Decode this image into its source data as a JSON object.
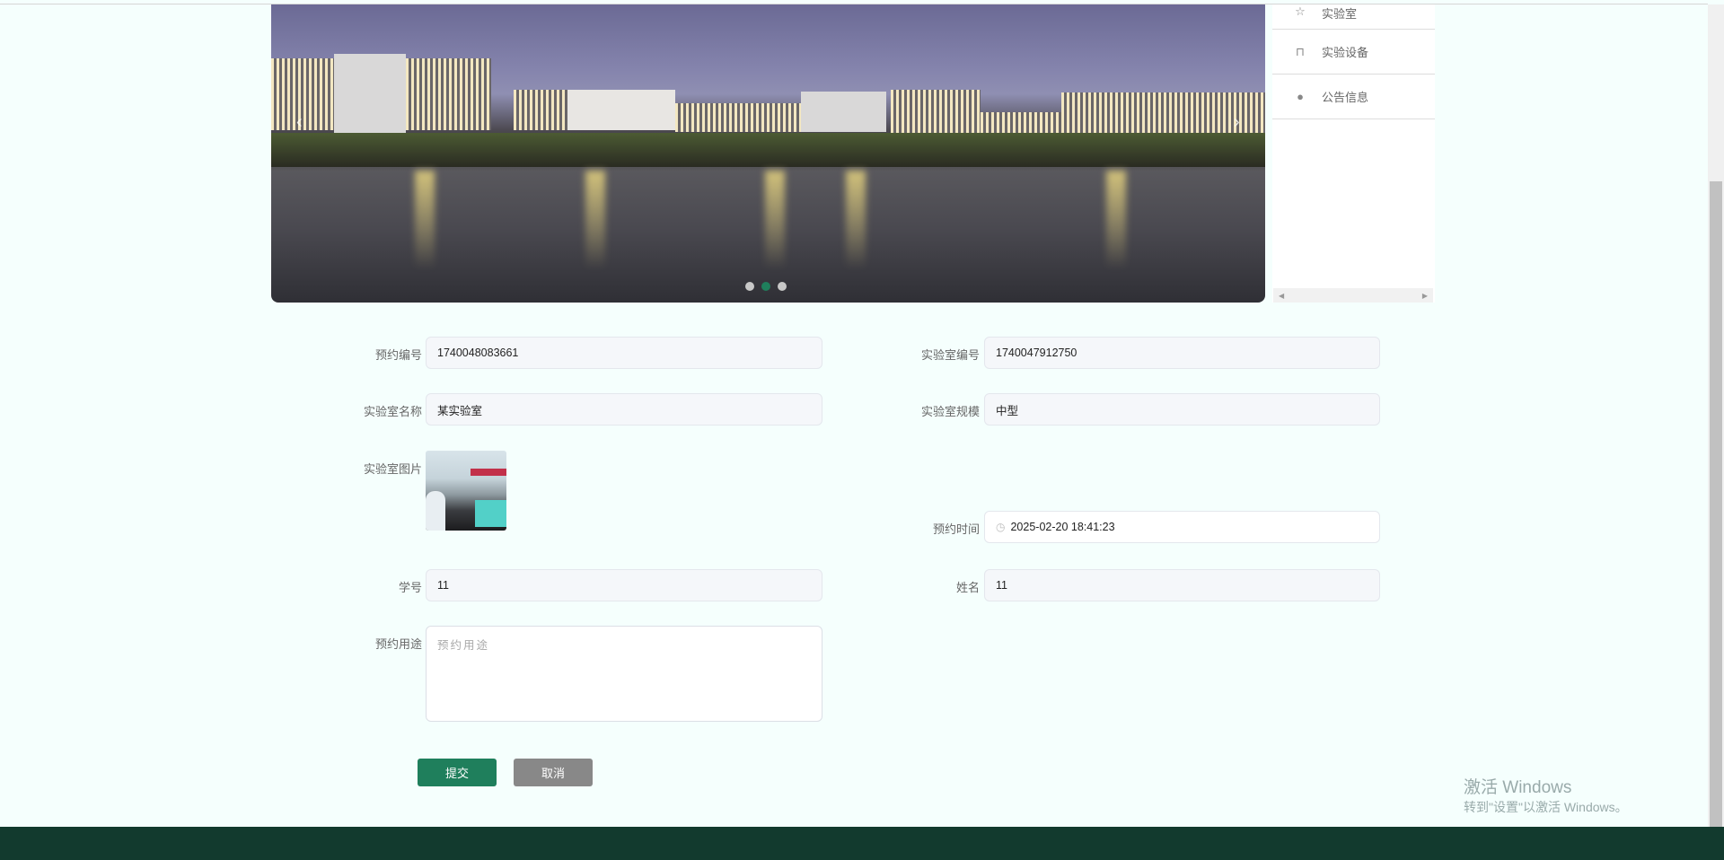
{
  "sidebar": {
    "items": [
      {
        "label": "实验室",
        "icon": "star-icon"
      },
      {
        "label": "实验设备",
        "icon": "bag-icon"
      },
      {
        "label": "公告信息",
        "icon": "alert-icon"
      }
    ]
  },
  "carousel": {
    "slides": 3,
    "active_index": 1
  },
  "form": {
    "booking_no": {
      "label": "预约编号",
      "value": "1740048083661"
    },
    "lab_no": {
      "label": "实验室编号",
      "value": "1740047912750"
    },
    "lab_name": {
      "label": "实验室名称",
      "value": "某实验室"
    },
    "lab_scale": {
      "label": "实验室规模",
      "value": "中型"
    },
    "lab_image": {
      "label": "实验室图片"
    },
    "booking_time": {
      "label": "预约时间",
      "value": "2025-02-20 18:41:23"
    },
    "student_no": {
      "label": "学号",
      "value": "11"
    },
    "name": {
      "label": "姓名",
      "value": "11"
    },
    "purpose": {
      "label": "预约用途",
      "placeholder": "预约用途"
    },
    "submit": "提交",
    "cancel": "取消"
  },
  "colors": {
    "primary": "#1f7f5c",
    "cancel": "#888888",
    "footer": "#123a2e"
  },
  "watermark": {
    "title": "激活 Windows",
    "subtitle": "转到\"设置\"以激活 Windows。"
  }
}
